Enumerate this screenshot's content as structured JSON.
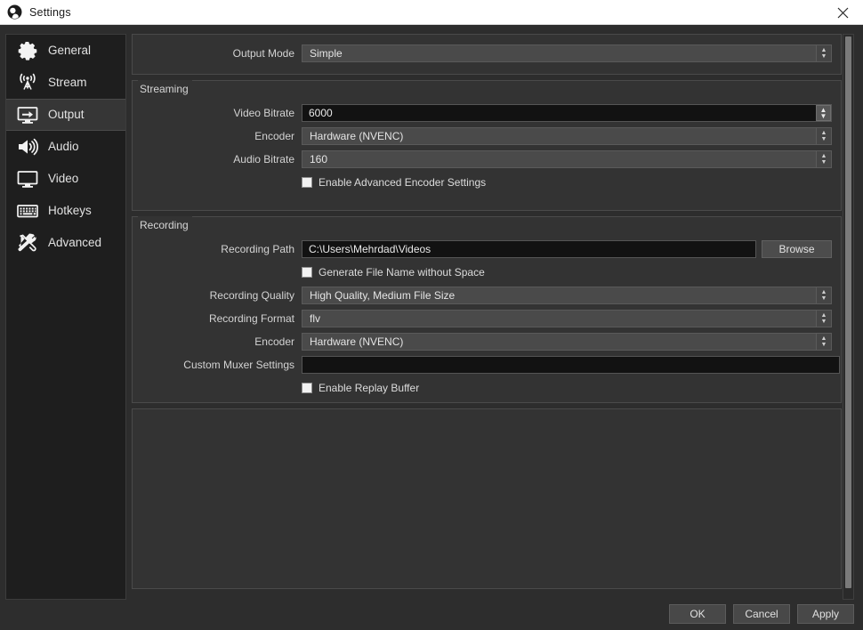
{
  "window": {
    "title": "Settings",
    "logo_icon": "obs-logo-icon",
    "close_icon": "close-icon"
  },
  "sidebar": {
    "items": [
      {
        "label": "General",
        "icon": "gear-icon",
        "selected": false
      },
      {
        "label": "Stream",
        "icon": "broadcast-icon",
        "selected": false
      },
      {
        "label": "Output",
        "icon": "output-monitor-icon",
        "selected": true
      },
      {
        "label": "Audio",
        "icon": "speaker-icon",
        "selected": false
      },
      {
        "label": "Video",
        "icon": "monitor-icon",
        "selected": false
      },
      {
        "label": "Hotkeys",
        "icon": "keyboard-icon",
        "selected": false
      },
      {
        "label": "Advanced",
        "icon": "tools-icon",
        "selected": false
      }
    ]
  },
  "output": {
    "mode": {
      "label": "Output Mode",
      "value": "Simple"
    },
    "streaming": {
      "group_title": "Streaming",
      "video_bitrate": {
        "label": "Video Bitrate",
        "value": "6000"
      },
      "encoder": {
        "label": "Encoder",
        "value": "Hardware (NVENC)"
      },
      "audio_bitrate": {
        "label": "Audio Bitrate",
        "value": "160"
      },
      "advanced_encoder": {
        "label": "Enable Advanced Encoder Settings",
        "checked": false
      }
    },
    "recording": {
      "group_title": "Recording",
      "path": {
        "label": "Recording Path",
        "value": "C:\\Users\\Mehrdad\\Videos"
      },
      "browse_label": "Browse",
      "no_space": {
        "label": "Generate File Name without Space",
        "checked": false
      },
      "quality": {
        "label": "Recording Quality",
        "value": "High Quality, Medium File Size"
      },
      "format": {
        "label": "Recording Format",
        "value": "flv"
      },
      "encoder": {
        "label": "Encoder",
        "value": "Hardware (NVENC)"
      },
      "muxer": {
        "label": "Custom Muxer Settings",
        "value": ""
      },
      "replay_buffer": {
        "label": "Enable Replay Buffer",
        "checked": false
      }
    }
  },
  "footer": {
    "ok": "OK",
    "cancel": "Cancel",
    "apply": "Apply"
  },
  "colors": {
    "titlebar_bg": "#ffffff",
    "dialog_bg": "#2d2d2d",
    "panel_bg": "#333333",
    "sidebar_bg": "#1e1e1e",
    "selected_nav": "#363636",
    "combo_bg": "#4a4a4a",
    "text_field_bg": "#121212",
    "text": "#d8d8d8"
  }
}
